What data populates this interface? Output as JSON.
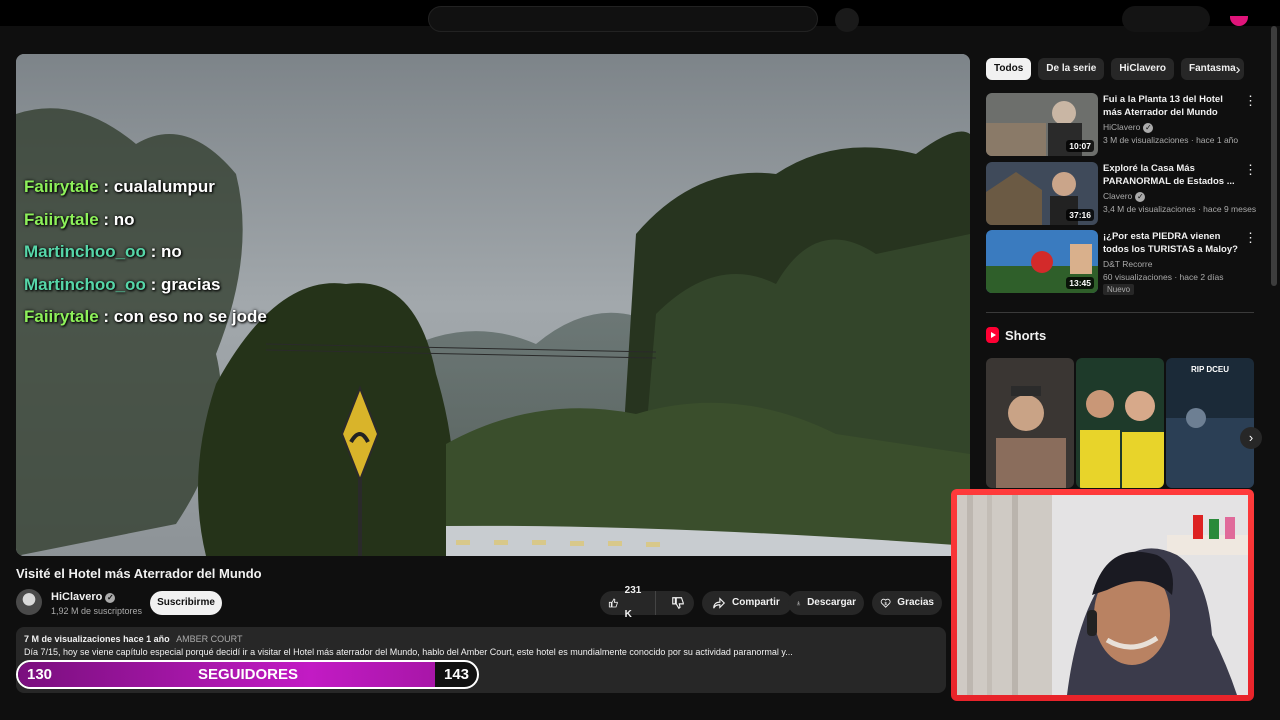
{
  "player": {
    "chat": [
      {
        "user": "Faiirytale",
        "message": ": cualalumpur"
      },
      {
        "user": "Faiirytale",
        "message": ": no"
      },
      {
        "user": "Martinchoo_oo",
        "message": ": no"
      },
      {
        "user": "Martinchoo_oo",
        "message": ": gracias"
      },
      {
        "user": "Faiirytale",
        "message": ": con eso no se jode"
      }
    ]
  },
  "video": {
    "title": "Visité el Hotel más Aterrador del Mundo",
    "channel": "HiClavero",
    "subscribers": "1,92 M de suscriptores",
    "subscribe_label": "Suscribirme",
    "likes": "231 K",
    "share_label": "Compartir",
    "download_label": "Descargar",
    "thanks_label": "Gracias"
  },
  "description": {
    "views": "7 M de visualizaciones",
    "age": "hace 1 año",
    "tag": "AMBER COURT",
    "text": "Día 7/15, hoy se viene capítulo especial porqué decidí ir a visitar el Hotel más aterrador del Mundo, hablo del Amber Court, este hotel es mundialmente conocido por su actividad paranormal y..."
  },
  "follower_goal": {
    "current": "130",
    "label": "SEGUIDORES",
    "goal": "143",
    "progress": 0.909
  },
  "sidebar": {
    "chips": [
      "Todos",
      "De la serie",
      "HiClavero",
      "Fantasma"
    ],
    "recommendations": [
      {
        "title": "Fui a la Planta 13 del Hotel más Aterrador del Mundo",
        "channel": "HiClavero",
        "meta": "3 M de visualizaciones · hace 1 año",
        "duration": "10:07",
        "badge": ""
      },
      {
        "title": "Exploré la Casa Más PARANORMAL de Estados ...",
        "channel": "Clavero",
        "meta": "3,4 M de visualizaciones · hace 9 meses",
        "duration": "37:16",
        "badge": ""
      },
      {
        "title": "¡¿Por esta PIEDRA vienen todos los TURISTAS a Maloy?",
        "channel": "D&T Recorre",
        "meta": "60 visualizaciones · hace 2 días",
        "duration": "13:45",
        "badge": "Nuevo"
      }
    ],
    "shorts_title": "Shorts",
    "short_thumb_text": "RIP DCEU"
  },
  "colors": {
    "background": "#0f0f0f",
    "chip_active": "#f1f1f1",
    "follow_fill": "#c21bc4",
    "cam_border": "#ff3b3b",
    "chat_user": "#8df05a",
    "chat_user_alt": "#56d6a8"
  },
  "icons": [
    "like-icon",
    "dislike-icon",
    "share-icon",
    "download-icon",
    "thanks-icon",
    "more-vert-icon",
    "chevron-right-icon",
    "shorts-logo-icon",
    "verified-icon"
  ]
}
